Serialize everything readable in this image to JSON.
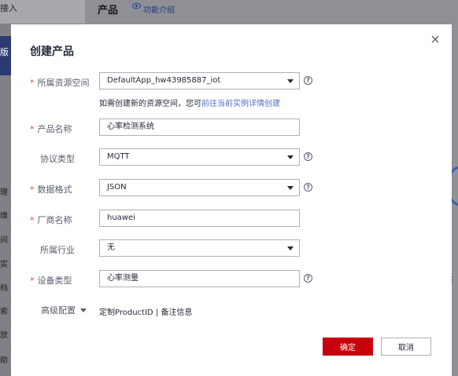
{
  "background": {
    "sidebar_header_text": "接入",
    "sidebar_active_text": "版",
    "sidebar_items": [
      "理",
      "维",
      "间",
      "实",
      "档",
      "索",
      "放",
      "助"
    ],
    "page_title": "产品",
    "feature_link": "功能介绍",
    "right_text": "<"
  },
  "dialog": {
    "title": "创建产品",
    "close_label": "×",
    "fields": {
      "resource_space": {
        "label": "所属资源空间",
        "value": "DefaultApp_hw43985887_iot"
      },
      "product_name": {
        "label": "产品名称",
        "value": "心率检测系统"
      },
      "protocol": {
        "label": "协议类型",
        "value": "MQTT"
      },
      "data_format": {
        "label": "数据格式",
        "value": "JSON"
      },
      "vendor": {
        "label": "厂商名称",
        "value": "huawei"
      },
      "industry": {
        "label": "所属行业",
        "value": "无"
      },
      "device_type": {
        "label": "设备类型",
        "value": "心率测量"
      }
    },
    "hint": {
      "text": "如需创建新的资源空间，您可",
      "link": "前往当前实例详情创建"
    },
    "advanced": {
      "label": "高级配置",
      "product_id": "定制ProductID",
      "separator": " | ",
      "remark": "备注信息"
    },
    "buttons": {
      "ok": "确定",
      "cancel": "取消"
    },
    "help_glyph": "?",
    "required_mark": "*"
  },
  "colors": {
    "primary": "#c7000b",
    "link": "#526ecc",
    "required": "#e54545"
  }
}
